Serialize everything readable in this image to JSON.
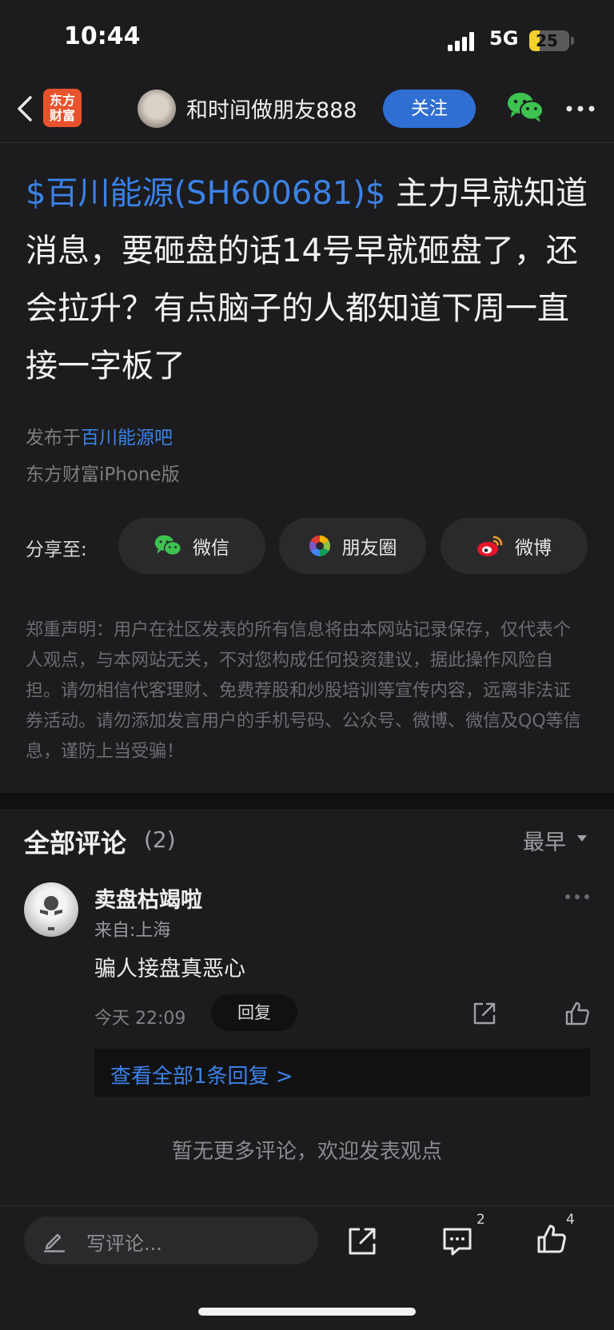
{
  "status_bar": {
    "time": "10:44",
    "network": "5G",
    "battery": "25",
    "battery_percent": 25
  },
  "nav": {
    "app_logo": "东方\n财富",
    "username": "和时间做朋友888",
    "follow_label": "关注",
    "icons": [
      "back-icon",
      "wechat-icon",
      "more-icon"
    ]
  },
  "post": {
    "stock_tag": "$百川能源(SH600681)$",
    "body": " 主力早就知道消息，要砸盘的话14号早就砸盘了，还会拉升？有点脑子的人都知道下周一直接一字板了",
    "published_prefix": "发布于",
    "forum": "百川能源吧",
    "device": "东方财富iPhone版"
  },
  "share": {
    "label": "分享至:",
    "options": [
      {
        "label": "微信",
        "icon": "wechat-icon"
      },
      {
        "label": "朋友圈",
        "icon": "moments-icon"
      },
      {
        "label": "微博",
        "icon": "weibo-icon"
      }
    ]
  },
  "disclaimer": "郑重声明：用户在社区发表的所有信息将由本网站记录保存，仅代表个人观点，与本网站无关，不对您构成任何投资建议，据此操作风险自担。请勿相信代客理财、免费荐股和炒股培训等宣传内容，远离非法证券活动。请勿添加发言用户的手机号码、公众号、微博、微信及QQ等信息，谨防上当受骗！",
  "comments": {
    "heading": "全部评论",
    "count": "(2)",
    "sort": "最早",
    "items": [
      {
        "author": "卖盘枯竭啦",
        "location": "来自:上海",
        "text": "骗人接盘真恶心",
        "time": "今天 22:09",
        "reply_label": "回复",
        "view_replies": "查看全部1条回复 >"
      }
    ],
    "no_more": "暂无更多评论，欢迎发表观点"
  },
  "bottom_bar": {
    "placeholder": "写评论...",
    "comment_count": "2",
    "like_count": "4"
  },
  "colors": {
    "background": "#1c1c1e",
    "accent_blue": "#3b82e8",
    "follow_button": "#2f6fd3",
    "brand_orange": "#e8532d",
    "wechat_green": "#3ec250",
    "weibo_red": "#e6162d"
  }
}
